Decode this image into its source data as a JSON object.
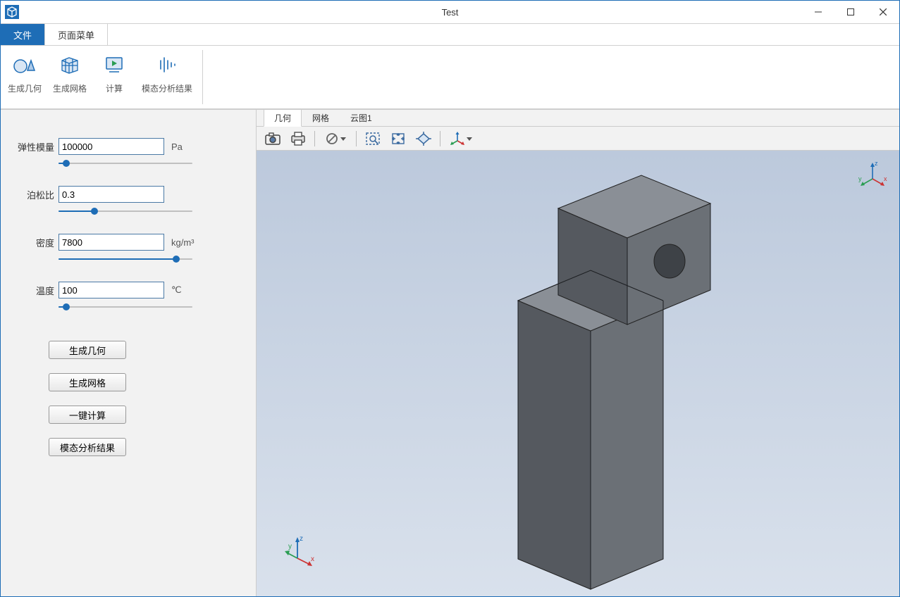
{
  "window": {
    "title": "Test"
  },
  "menu": {
    "tabs": [
      {
        "label": "文件",
        "active": true
      },
      {
        "label": "页面菜单",
        "active": false
      }
    ]
  },
  "ribbon": {
    "items": [
      {
        "label": "生成几何",
        "icon": "geometry-icon"
      },
      {
        "label": "生成网格",
        "icon": "mesh-icon"
      },
      {
        "label": "计算",
        "icon": "compute-icon"
      },
      {
        "label": "模态分析结果",
        "icon": "results-icon"
      }
    ]
  },
  "sidebar": {
    "fields": {
      "elastic_modulus": {
        "label": "弹性模量",
        "value": "100000",
        "unit": "Pa",
        "slider_pct": 6
      },
      "poisson_ratio": {
        "label": "泊松比",
        "value": "0.3",
        "unit": "",
        "slider_pct": 27
      },
      "density": {
        "label": "密度",
        "value": "7800",
        "unit": "kg/m³",
        "slider_pct": 88
      },
      "temperature": {
        "label": "温度",
        "value": "100",
        "unit": "℃",
        "slider_pct": 6
      }
    },
    "buttons": {
      "gen_geometry": "生成几何",
      "gen_mesh": "生成网格",
      "compute": "一键计算",
      "results": "模态分析结果"
    }
  },
  "viewer": {
    "tabs": [
      {
        "label": "几何",
        "active": true
      },
      {
        "label": "网格",
        "active": false
      },
      {
        "label": "云图1",
        "active": false
      }
    ],
    "axis_labels": {
      "x": "x",
      "y": "y",
      "z": "z"
    }
  }
}
